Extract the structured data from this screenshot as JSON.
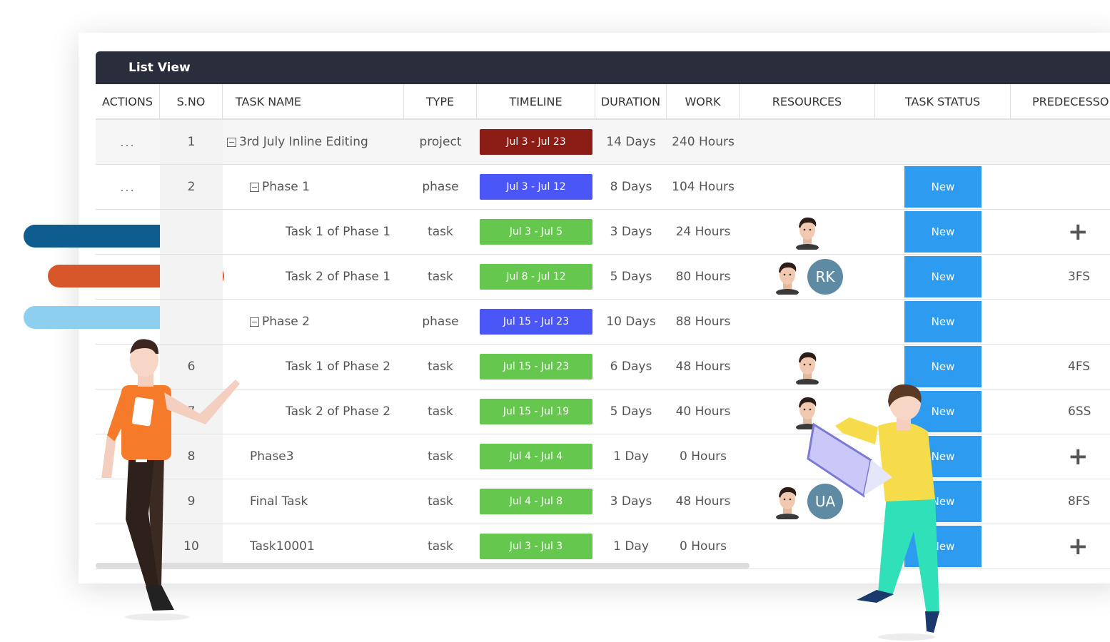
{
  "window": {
    "title": "List View"
  },
  "colors": {
    "header_bg": "#2a2d3c",
    "project": "#8b1d14",
    "phase": "#4a56f5",
    "task": "#66c74e",
    "status_new": "#2d9bf0",
    "avatar_initials": "#5f8aa4",
    "deco_blue": "#0f5d8e",
    "deco_orange": "#d8572a",
    "deco_light": "#8ccfee"
  },
  "columns": [
    "ACTIONS",
    "S.NO",
    "TASK NAME",
    "TYPE",
    "TIMELINE",
    "DURATION",
    "WORK",
    "RESOURCES",
    "TASK STATUS",
    "PREDECESSO"
  ],
  "rows": [
    {
      "actions": "...",
      "sno": "1",
      "name": "3rd July Inline Editing",
      "expander": true,
      "indent": 0,
      "type": "project",
      "timeline": "Jul 3 - Jul 23",
      "timeline_kind": "project",
      "duration": "14 Days",
      "work": "240 Hours",
      "resources": [],
      "status": "",
      "pred": ""
    },
    {
      "actions": "...",
      "sno": "2",
      "name": "Phase 1",
      "expander": true,
      "indent": 1,
      "type": "phase",
      "timeline": "Jul 3 - Jul 12",
      "timeline_kind": "phase",
      "duration": "8 Days",
      "work": "104 Hours",
      "resources": [],
      "status": "New",
      "pred": ""
    },
    {
      "actions": "",
      "sno": "",
      "name": "Task 1 of Phase 1",
      "expander": false,
      "indent": 2,
      "type": "task",
      "timeline": "Jul 3 - Jul 5",
      "timeline_kind": "task",
      "duration": "3 Days",
      "work": "24 Hours",
      "resources": [
        {
          "kind": "photo"
        }
      ],
      "status": "New",
      "pred": "+"
    },
    {
      "actions": "",
      "sno": "",
      "name": "Task 2 of Phase 1",
      "expander": false,
      "indent": 2,
      "type": "task",
      "timeline": "Jul 8 - Jul 12",
      "timeline_kind": "task",
      "duration": "5 Days",
      "work": "80 Hours",
      "resources": [
        {
          "kind": "photo"
        },
        {
          "kind": "initials",
          "text": "RK"
        }
      ],
      "status": "New",
      "pred": "3FS"
    },
    {
      "actions": "",
      "sno": "",
      "name": "Phase 2",
      "expander": true,
      "indent": 1,
      "type": "phase",
      "timeline": "Jul 15 - Jul 23",
      "timeline_kind": "phase",
      "duration": "10 Days",
      "work": "88 Hours",
      "resources": [],
      "status": "New",
      "pred": ""
    },
    {
      "actions": "",
      "sno": "6",
      "name": "Task 1 of Phase 2",
      "expander": false,
      "indent": 2,
      "type": "task",
      "timeline": "Jul 15 - Jul 23",
      "timeline_kind": "task",
      "duration": "6 Days",
      "work": "48 Hours",
      "resources": [
        {
          "kind": "photo"
        }
      ],
      "status": "New",
      "pred": "4FS"
    },
    {
      "actions": "",
      "sno": "7",
      "name": "Task 2 of Phase 2",
      "expander": false,
      "indent": 2,
      "type": "task",
      "timeline": "Jul 15 - Jul 19",
      "timeline_kind": "task",
      "duration": "5 Days",
      "work": "40 Hours",
      "resources": [
        {
          "kind": "photo"
        }
      ],
      "status": "New",
      "pred": "6SS"
    },
    {
      "actions": "",
      "sno": "8",
      "name": "Phase3",
      "expander": false,
      "indent": 1,
      "type": "task",
      "timeline": "Jul 4 - Jul 4",
      "timeline_kind": "task",
      "duration": "1 Day",
      "work": "0 Hours",
      "resources": [],
      "status": "New",
      "pred": "+"
    },
    {
      "actions": "",
      "sno": "9",
      "name": "Final Task",
      "expander": false,
      "indent": 1,
      "type": "task",
      "timeline": "Jul 4 - Jul 8",
      "timeline_kind": "task",
      "duration": "3 Days",
      "work": "48 Hours",
      "resources": [
        {
          "kind": "photo"
        },
        {
          "kind": "initials",
          "text": "UA"
        }
      ],
      "status": "New",
      "pred": "8FS"
    },
    {
      "actions": "",
      "sno": "10",
      "name": "Task10001",
      "expander": false,
      "indent": 1,
      "type": "task",
      "timeline": "Jul 3 - Jul 3",
      "timeline_kind": "task",
      "duration": "1 Day",
      "work": "0 Hours",
      "resources": [],
      "status": "New",
      "pred": "+"
    }
  ]
}
